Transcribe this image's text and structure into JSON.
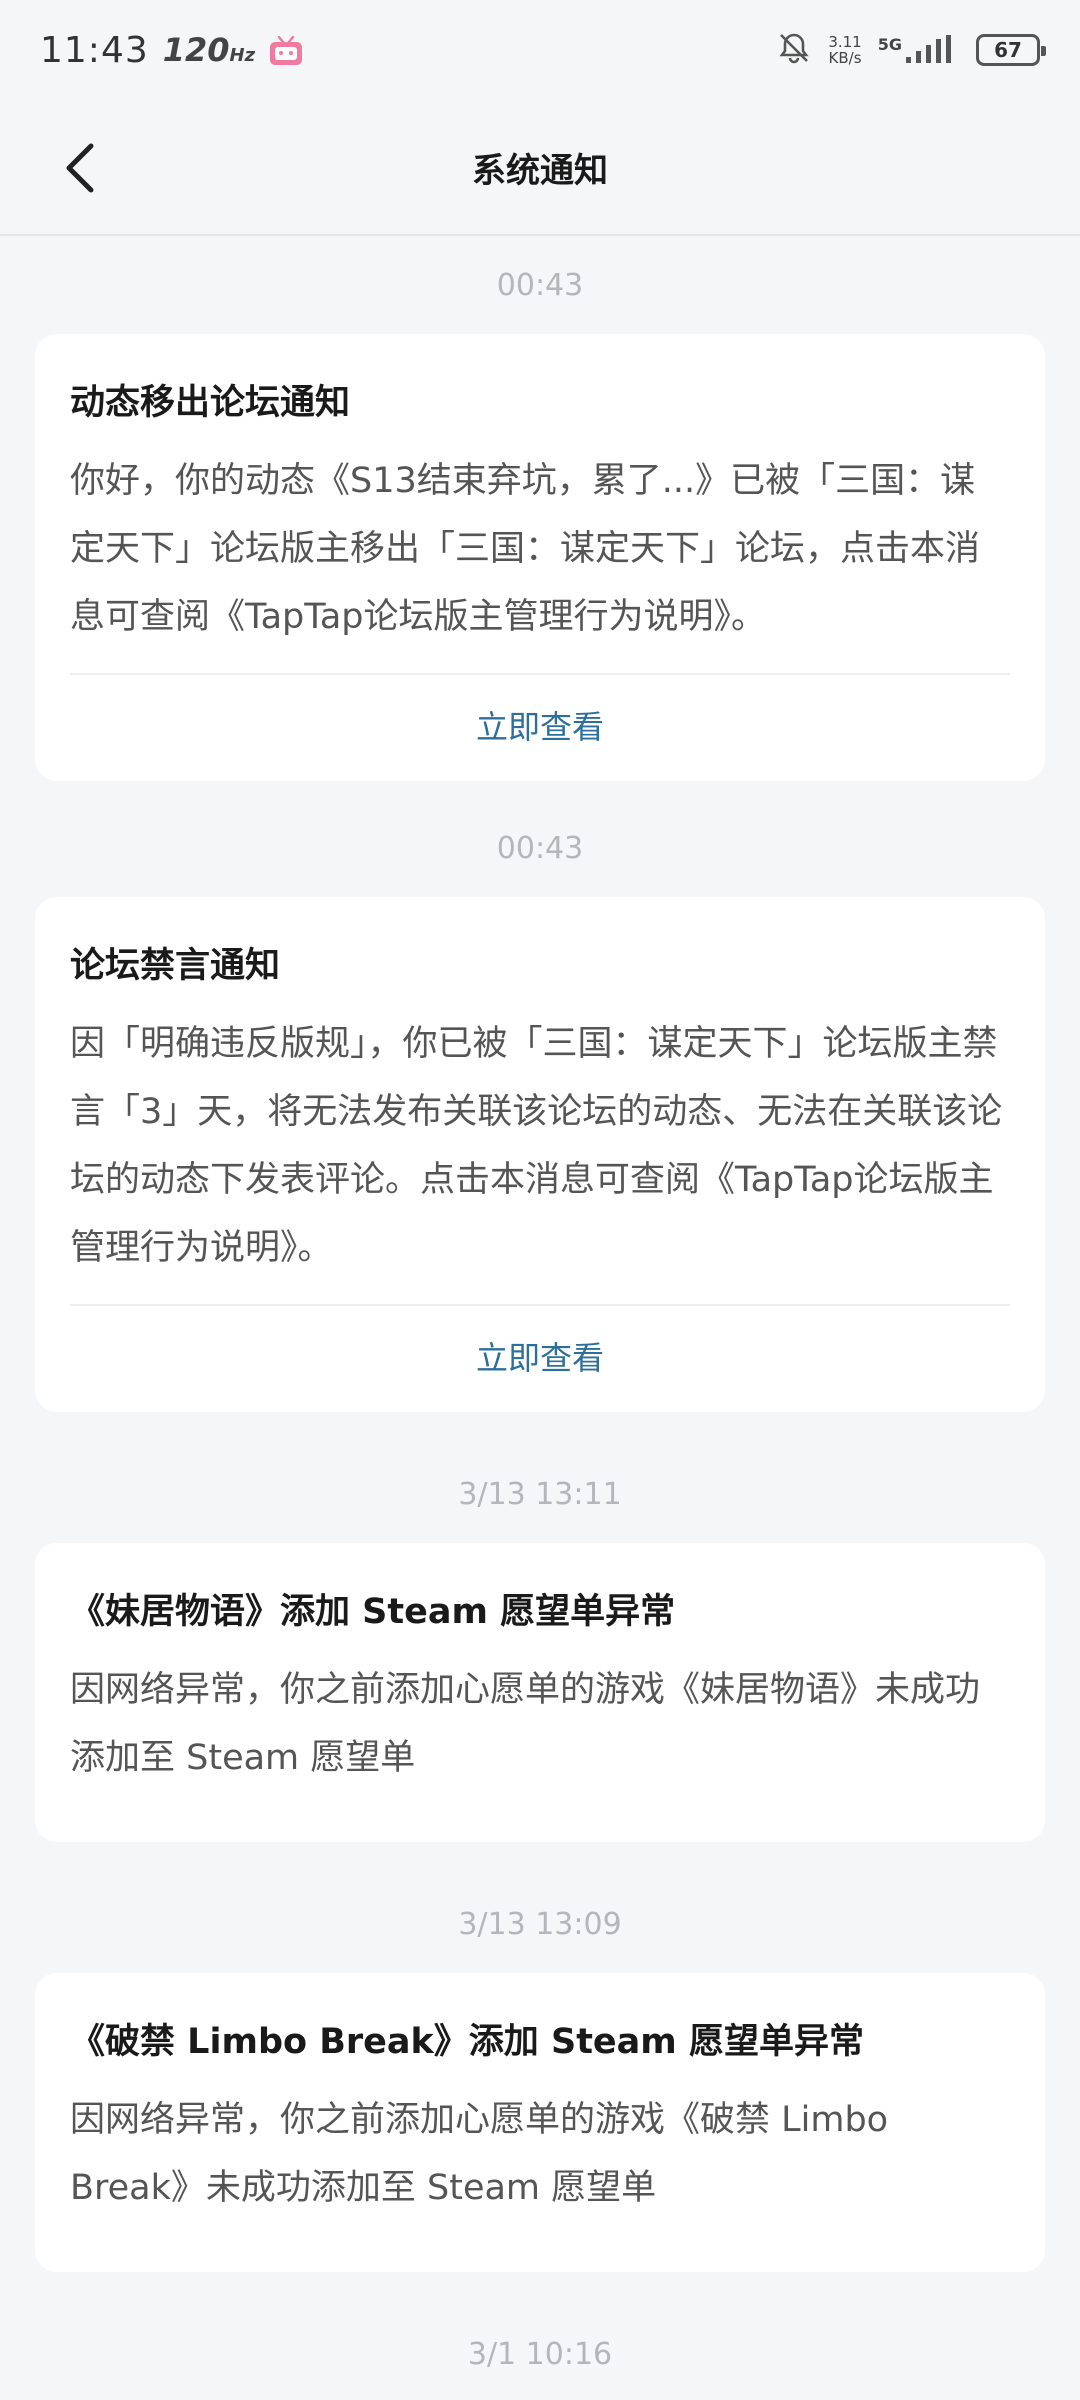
{
  "status_bar": {
    "time": "11:43",
    "refresh_rate": "120",
    "refresh_unit": "Hz",
    "net_speed_value": "3.11",
    "net_speed_unit": "KB/s",
    "network_type": "5G",
    "battery": "67"
  },
  "header": {
    "title": "系统通知"
  },
  "notifications": [
    {
      "time": "00:43",
      "title": "动态移出论坛通知",
      "body": "你好，你的动态《S13结束弃坑，累了...》已被「三国：谋定天下」论坛版主移出「三国：谋定天下」论坛，点击本消息可查阅《TapTap论坛版主管理行为说明》。",
      "action": "立即查看"
    },
    {
      "time": "00:43",
      "title": "论坛禁言通知",
      "body": "因「明确违反版规」，你已被「三国：谋定天下」论坛版主禁言「3」天，将无法发布关联该论坛的动态、无法在关联该论坛的动态下发表评论。点击本消息可查阅《TapTap论坛版主管理行为说明》。",
      "action": "立即查看"
    },
    {
      "time": "3/13  13:11",
      "title": "《妹居物语》添加 Steam 愿望单异常",
      "body": "因网络异常，你之前添加心愿单的游戏《妹居物语》未成功添加至 Steam 愿望单"
    },
    {
      "time": "3/13  13:09",
      "title": "《破禁 Limbo Break》添加 Steam 愿望单异常",
      "body": "因网络异常，你之前添加心愿单的游戏《破禁 Limbo Break》未成功添加至 Steam 愿望单"
    }
  ],
  "next_time": "3/1  10:16"
}
